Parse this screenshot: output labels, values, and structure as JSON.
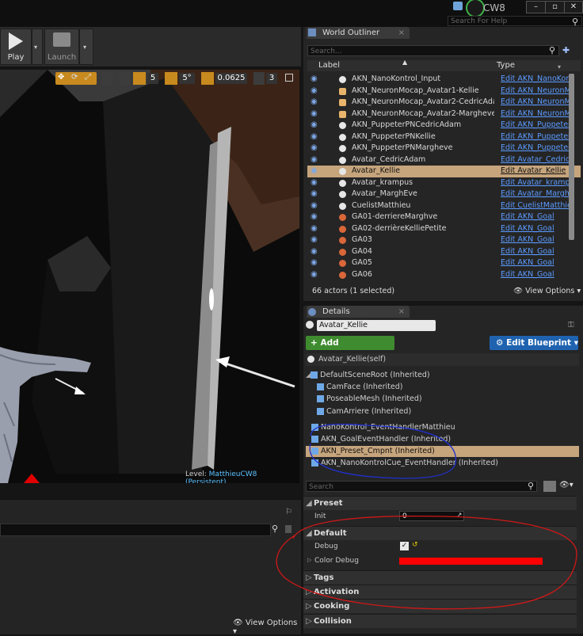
{
  "topbar": {
    "project": "CW8",
    "help_search_placeholder": "Search For Help"
  },
  "toolbar": {
    "play_label": "Play",
    "launch_label": "Launch"
  },
  "viewport_toolbar": {
    "grid_snap": "5",
    "rotation_snap": "5°",
    "scale_snap": "0.0625",
    "camera_speed": "3"
  },
  "viewport": {
    "level_label": "Level:",
    "level_name": "MatthieuCW8 (Persistent)"
  },
  "lower_panel": {
    "view_options": "View Options"
  },
  "world_outliner": {
    "tab": "World Outliner",
    "search_placeholder": "Search...",
    "col_label": "Label",
    "col_type": "Type",
    "rows": [
      {
        "label": "AKN_NanoKontrol_Input",
        "type": "Edit AKN_NanoKontr",
        "icon": "actor-icon"
      },
      {
        "label": "AKN_NeuronMocap_Avatar1-Kellie",
        "type": "Edit AKN_NeuronMo",
        "icon": "pawn-icon"
      },
      {
        "label": "AKN_NeuronMocap_Avatar2-CedricAdam",
        "type": "Edit AKN_NeuronMo",
        "icon": "pawn-icon"
      },
      {
        "label": "AKN_NeuronMocap_Avatar2-Margheve",
        "type": "Edit AKN_NeuronMo",
        "icon": "pawn-icon"
      },
      {
        "label": "AKN_PuppeterPNCedricAdam",
        "type": "Edit AKN_Puppeter",
        "icon": "actor-icon"
      },
      {
        "label": "AKN_PuppeterPNKellie",
        "type": "Edit AKN_Puppeter",
        "icon": "actor-icon"
      },
      {
        "label": "AKN_PuppeterPNMargheve",
        "type": "Edit AKN_Puppeter",
        "icon": "actor-icon"
      },
      {
        "label": "Avatar_CedricAdam",
        "type": "Edit Avatar_CedricAd",
        "icon": "actor-icon"
      },
      {
        "label": "Avatar_Kellie",
        "type": "Edit Avatar_Kellie",
        "icon": "actor-icon",
        "selected": true
      },
      {
        "label": "Avatar_krampus",
        "type": "Edit Avatar_krampus",
        "icon": "actor-icon"
      },
      {
        "label": "Avatar_MarghEve",
        "type": "Edit Avatar_MarghEv",
        "icon": "actor-icon"
      },
      {
        "label": "CuelistMatthieu",
        "type": "Edit CuelistMatthieu",
        "icon": "actor-icon"
      },
      {
        "label": "GA01-derriereMarghve",
        "type": "Edit AKN_Goal",
        "icon": "goal-icon"
      },
      {
        "label": "GA02-derrièreKelliePetite",
        "type": "Edit AKN_Goal",
        "icon": "goal-icon"
      },
      {
        "label": "GA03",
        "type": "Edit AKN_Goal",
        "icon": "goal-icon"
      },
      {
        "label": "GA04",
        "type": "Edit AKN_Goal",
        "icon": "goal-icon"
      },
      {
        "label": "GA05",
        "type": "Edit AKN_Goal",
        "icon": "goal-icon"
      },
      {
        "label": "GA06",
        "type": "Edit AKN_Goal",
        "icon": "goal-icon"
      }
    ],
    "actor_count": "66 actors (1 selected)",
    "view_options": "View Options"
  },
  "details": {
    "tab": "Details",
    "name_value": "Avatar_Kellie",
    "add_component": "+ Add Component",
    "edit_blueprint": "Edit Blueprint",
    "self_label": "Avatar_Kellie(self)",
    "components": [
      {
        "label": "DefaultSceneRoot (Inherited)"
      },
      {
        "label": "CamFace (Inherited)"
      },
      {
        "label": "PoseableMesh (Inherited)"
      },
      {
        "label": "CamArriere (Inherited)"
      },
      {
        "label": "NanoKontrol_EventHandlerMatthieu"
      },
      {
        "label": "AKN_GoalEventHandler (Inherited)"
      },
      {
        "label": "AKN_Preset_Cmpnt (Inherited)",
        "selected": true
      },
      {
        "label": "AKN_NanoKontrolCue_EventHandler (Inherited)"
      }
    ],
    "search_placeholder": "Search",
    "categories": {
      "preset": "Preset",
      "default": "Default",
      "tags": "Tags",
      "activation": "Activation",
      "cooking": "Cooking",
      "collision": "Collision"
    },
    "props": {
      "init_label": "Init",
      "init_value": "0",
      "debug_label": "Debug",
      "color_debug_label": "Color Debug",
      "color_debug_value": "#ff0000"
    }
  },
  "colors": {
    "selection": "#c6a57d",
    "link": "#5b9bff",
    "add_component_green": "#3f8b2f",
    "edit_blueprint_blue": "#1f63b0"
  }
}
